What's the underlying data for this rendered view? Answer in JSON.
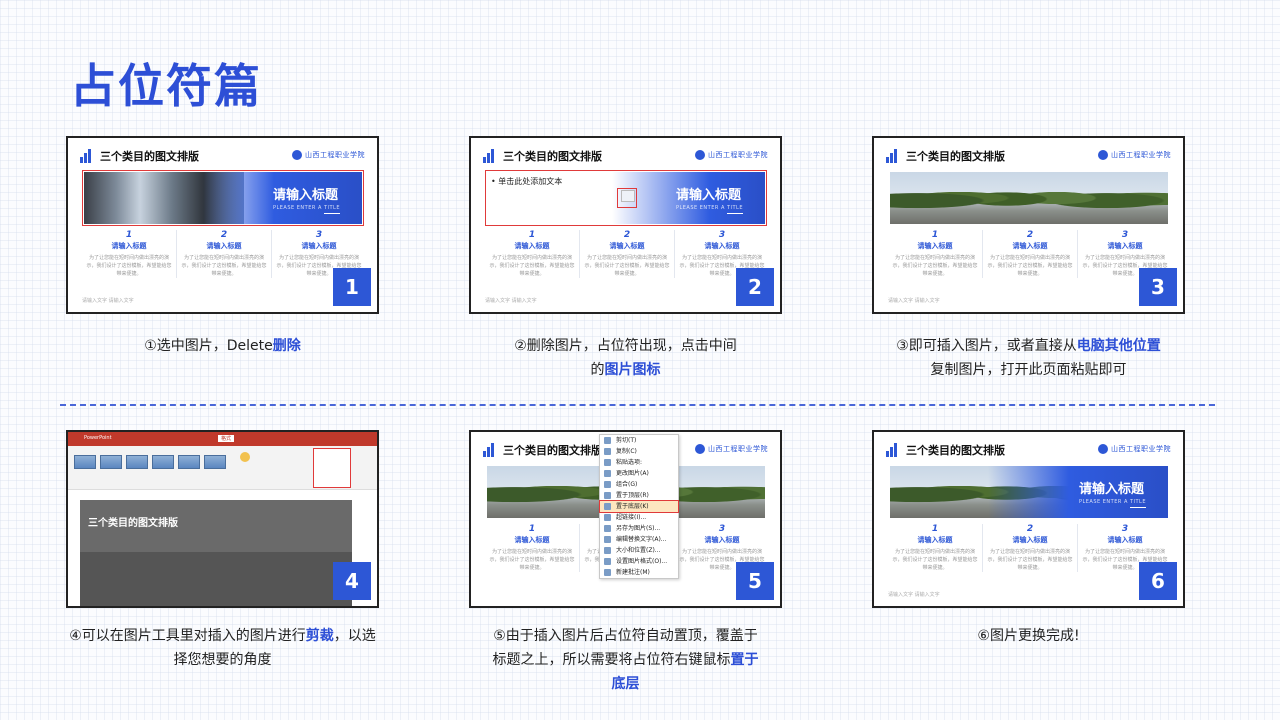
{
  "page_title": "占位符篇",
  "slide_common": {
    "title": "三个类目的图文排版",
    "school": "山西工程职业学院",
    "banner_title": "请输入标题",
    "banner_sub": "PLEASE ENTER A TITLE",
    "columns": [
      {
        "title": "请输入标题",
        "body": "为了让您能在短时间内做出漂亮的演示，我们设计了这份模板，希望能给您带来便捷。"
      },
      {
        "title": "请输入标题",
        "body": "为了让您能在短时间内做出漂亮的演示，我们设计了这份模板，希望能给您带来便捷。"
      },
      {
        "title": "请输入标题",
        "body": "为了让您能在短时间内做出漂亮的演示，我们设计了这份模板，希望能给您带来便捷。"
      }
    ],
    "footer": "请输入文字 请输入文字"
  },
  "slide2_placeholder": "• 单击此处添加文本",
  "steps": [
    {
      "num": "1",
      "caption_pre": "①选中图片，Delete",
      "caption_hl": "删除",
      "caption_post": ""
    },
    {
      "num": "2",
      "caption_pre": "②删除图片，占位符出现，点击中间的",
      "caption_hl": "图片图标",
      "caption_post": ""
    },
    {
      "num": "3",
      "caption_pre": "③即可插入图片，或者直接从",
      "caption_hl": "电脑其他位置",
      "caption_post": "复制图片，打开此页面粘贴即可"
    },
    {
      "num": "4",
      "caption_pre": "④可以在图片工具里对插入的图片进行",
      "caption_hl": "剪裁",
      "caption_post": "，以选择您想要的角度"
    },
    {
      "num": "5",
      "caption_pre": "⑤由于插入图片后占位符自动置顶，覆盖于标题之上，所以需要将占位符右键鼠标",
      "caption_hl": "置于底层",
      "caption_post": ""
    },
    {
      "num": "6",
      "caption_pre": "⑥图片更换完成!",
      "caption_hl": "",
      "caption_post": ""
    }
  ],
  "context_menu": [
    "剪切(T)",
    "复制(C)",
    "粘贴选项:",
    "更改图片(A)",
    "组合(G)",
    "置于顶层(R)",
    "置于底层(K)",
    "超链接(I)...",
    "另存为图片(S)...",
    "编辑替换文字(A)...",
    "大小和位置(Z)...",
    "设置图片格式(O)...",
    "新建批注(M)"
  ],
  "ppt_app": {
    "title": "PowerPoint",
    "tab": "格式"
  }
}
